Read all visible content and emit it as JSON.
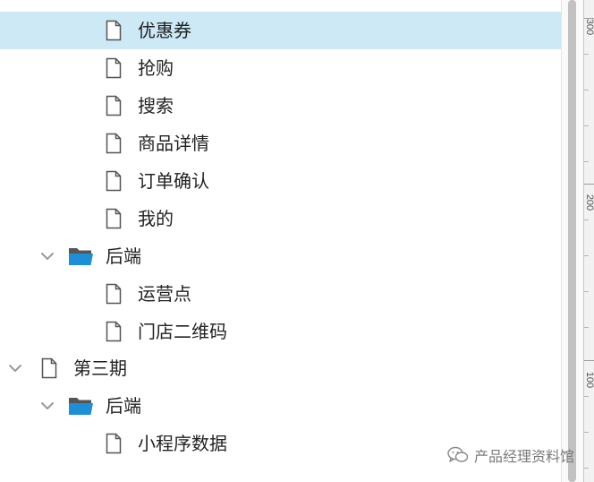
{
  "tree": {
    "rows": [
      {
        "type": "file",
        "label": "优惠券",
        "selected": true
      },
      {
        "type": "file",
        "label": "抢购"
      },
      {
        "type": "file",
        "label": "搜索"
      },
      {
        "type": "file",
        "label": "商品详情"
      },
      {
        "type": "file",
        "label": "订单确认"
      },
      {
        "type": "file",
        "label": "我的"
      },
      {
        "type": "folder",
        "label": "后端",
        "expanded": true
      },
      {
        "type": "file",
        "label": "运营点"
      },
      {
        "type": "file",
        "label": "门店二维码"
      },
      {
        "type": "page",
        "label": "第三期",
        "expanded": true
      },
      {
        "type": "folder",
        "label": "后端",
        "expanded": true
      },
      {
        "type": "file",
        "label": "小程序数据"
      }
    ]
  },
  "ruler": {
    "labels": [
      "300",
      "200",
      "100"
    ]
  },
  "watermark": {
    "text": "产品经理资料馆"
  },
  "colors": {
    "selected_row": "#cce9f5",
    "folder_blue": "#1d8fd6",
    "folder_dark": "#555555"
  }
}
